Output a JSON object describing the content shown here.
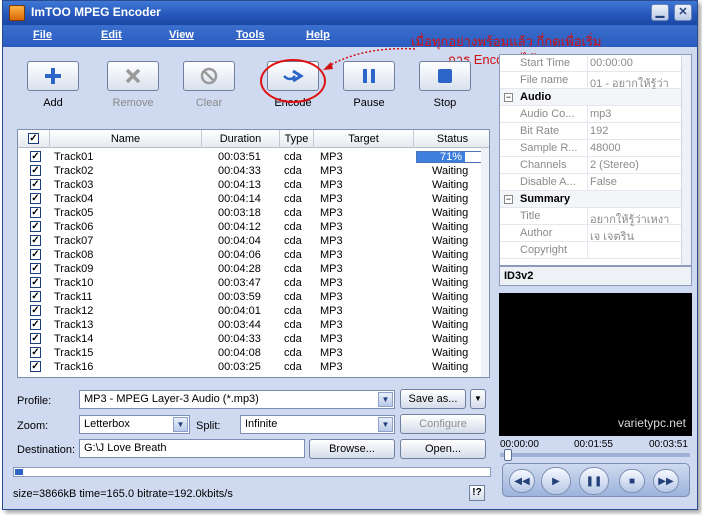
{
  "window": {
    "title": "ImTOO MPEG Encoder"
  },
  "menu": [
    "File",
    "Edit",
    "View",
    "Tools",
    "Help"
  ],
  "toolbar": {
    "add": "Add",
    "remove": "Remove",
    "clear": "Clear",
    "encode": "Encode",
    "pause": "Pause",
    "stop": "Stop"
  },
  "annotation": {
    "line1": "เมื่อทุกอย่างพร้อมแล้ว กี่กดเพื่อเริ่ม",
    "line2": "การ Encode ได้เลย"
  },
  "list": {
    "headers": {
      "name": "Name",
      "duration": "Duration",
      "type": "Type",
      "target": "Target",
      "status": "Status"
    },
    "rows": [
      {
        "name": "Track01",
        "duration": "00:03:51",
        "type": "cda",
        "target": "MP3",
        "status": "71%"
      },
      {
        "name": "Track02",
        "duration": "00:04:33",
        "type": "cda",
        "target": "MP3",
        "status": "Waiting"
      },
      {
        "name": "Track03",
        "duration": "00:04:13",
        "type": "cda",
        "target": "MP3",
        "status": "Waiting"
      },
      {
        "name": "Track04",
        "duration": "00:04:14",
        "type": "cda",
        "target": "MP3",
        "status": "Waiting"
      },
      {
        "name": "Track05",
        "duration": "00:03:18",
        "type": "cda",
        "target": "MP3",
        "status": "Waiting"
      },
      {
        "name": "Track06",
        "duration": "00:04:12",
        "type": "cda",
        "target": "MP3",
        "status": "Waiting"
      },
      {
        "name": "Track07",
        "duration": "00:04:04",
        "type": "cda",
        "target": "MP3",
        "status": "Waiting"
      },
      {
        "name": "Track08",
        "duration": "00:04:06",
        "type": "cda",
        "target": "MP3",
        "status": "Waiting"
      },
      {
        "name": "Track09",
        "duration": "00:04:28",
        "type": "cda",
        "target": "MP3",
        "status": "Waiting"
      },
      {
        "name": "Track10",
        "duration": "00:03:47",
        "type": "cda",
        "target": "MP3",
        "status": "Waiting"
      },
      {
        "name": "Track11",
        "duration": "00:03:59",
        "type": "cda",
        "target": "MP3",
        "status": "Waiting"
      },
      {
        "name": "Track12",
        "duration": "00:04:01",
        "type": "cda",
        "target": "MP3",
        "status": "Waiting"
      },
      {
        "name": "Track13",
        "duration": "00:03:44",
        "type": "cda",
        "target": "MP3",
        "status": "Waiting"
      },
      {
        "name": "Track14",
        "duration": "00:04:33",
        "type": "cda",
        "target": "MP3",
        "status": "Waiting"
      },
      {
        "name": "Track15",
        "duration": "00:04:08",
        "type": "cda",
        "target": "MP3",
        "status": "Waiting"
      },
      {
        "name": "Track16",
        "duration": "00:03:25",
        "type": "cda",
        "target": "MP3",
        "status": "Waiting"
      }
    ],
    "progress_fraction": 0.71
  },
  "profile": {
    "label": "Profile:",
    "value": "MP3 - MPEG Layer-3 Audio  (*.mp3)",
    "save_as": "Save as..."
  },
  "zoom": {
    "label": "Zoom:",
    "value": "Letterbox"
  },
  "split": {
    "label": "Split:",
    "value": "Infinite",
    "configure": "Configure"
  },
  "destination": {
    "label": "Destination:",
    "value": "G:\\J Love Breath",
    "browse": "Browse...",
    "open": "Open..."
  },
  "statusbar": {
    "text": "size=3866kB time=165.0 bitrate=192.0kbits/s",
    "help": "!?"
  },
  "properties": {
    "rows": [
      {
        "key": "Start Time",
        "value": "00:00:00"
      },
      {
        "key": "File name",
        "value": "01 - อยากให้รู้ว่า"
      },
      {
        "section": "Audio"
      },
      {
        "key": "Audio Co...",
        "value": "mp3"
      },
      {
        "key": "Bit Rate",
        "value": "192"
      },
      {
        "key": "Sample R...",
        "value": "48000"
      },
      {
        "key": "Channels",
        "value": "2 (Stereo)"
      },
      {
        "key": "Disable A...",
        "value": "False"
      },
      {
        "section": "Summary"
      },
      {
        "key": "Title",
        "value": "อยากให้รู้ว่าเหงา"
      },
      {
        "key": "Author",
        "value": "เจ เจตริน"
      },
      {
        "key": "Copyright",
        "value": ""
      }
    ],
    "tag": "ID3v2"
  },
  "preview": {
    "watermark": "varietypc.net"
  },
  "player": {
    "time_start": "00:00:00",
    "time_current": "00:01:55",
    "time_end": "00:03:51"
  }
}
